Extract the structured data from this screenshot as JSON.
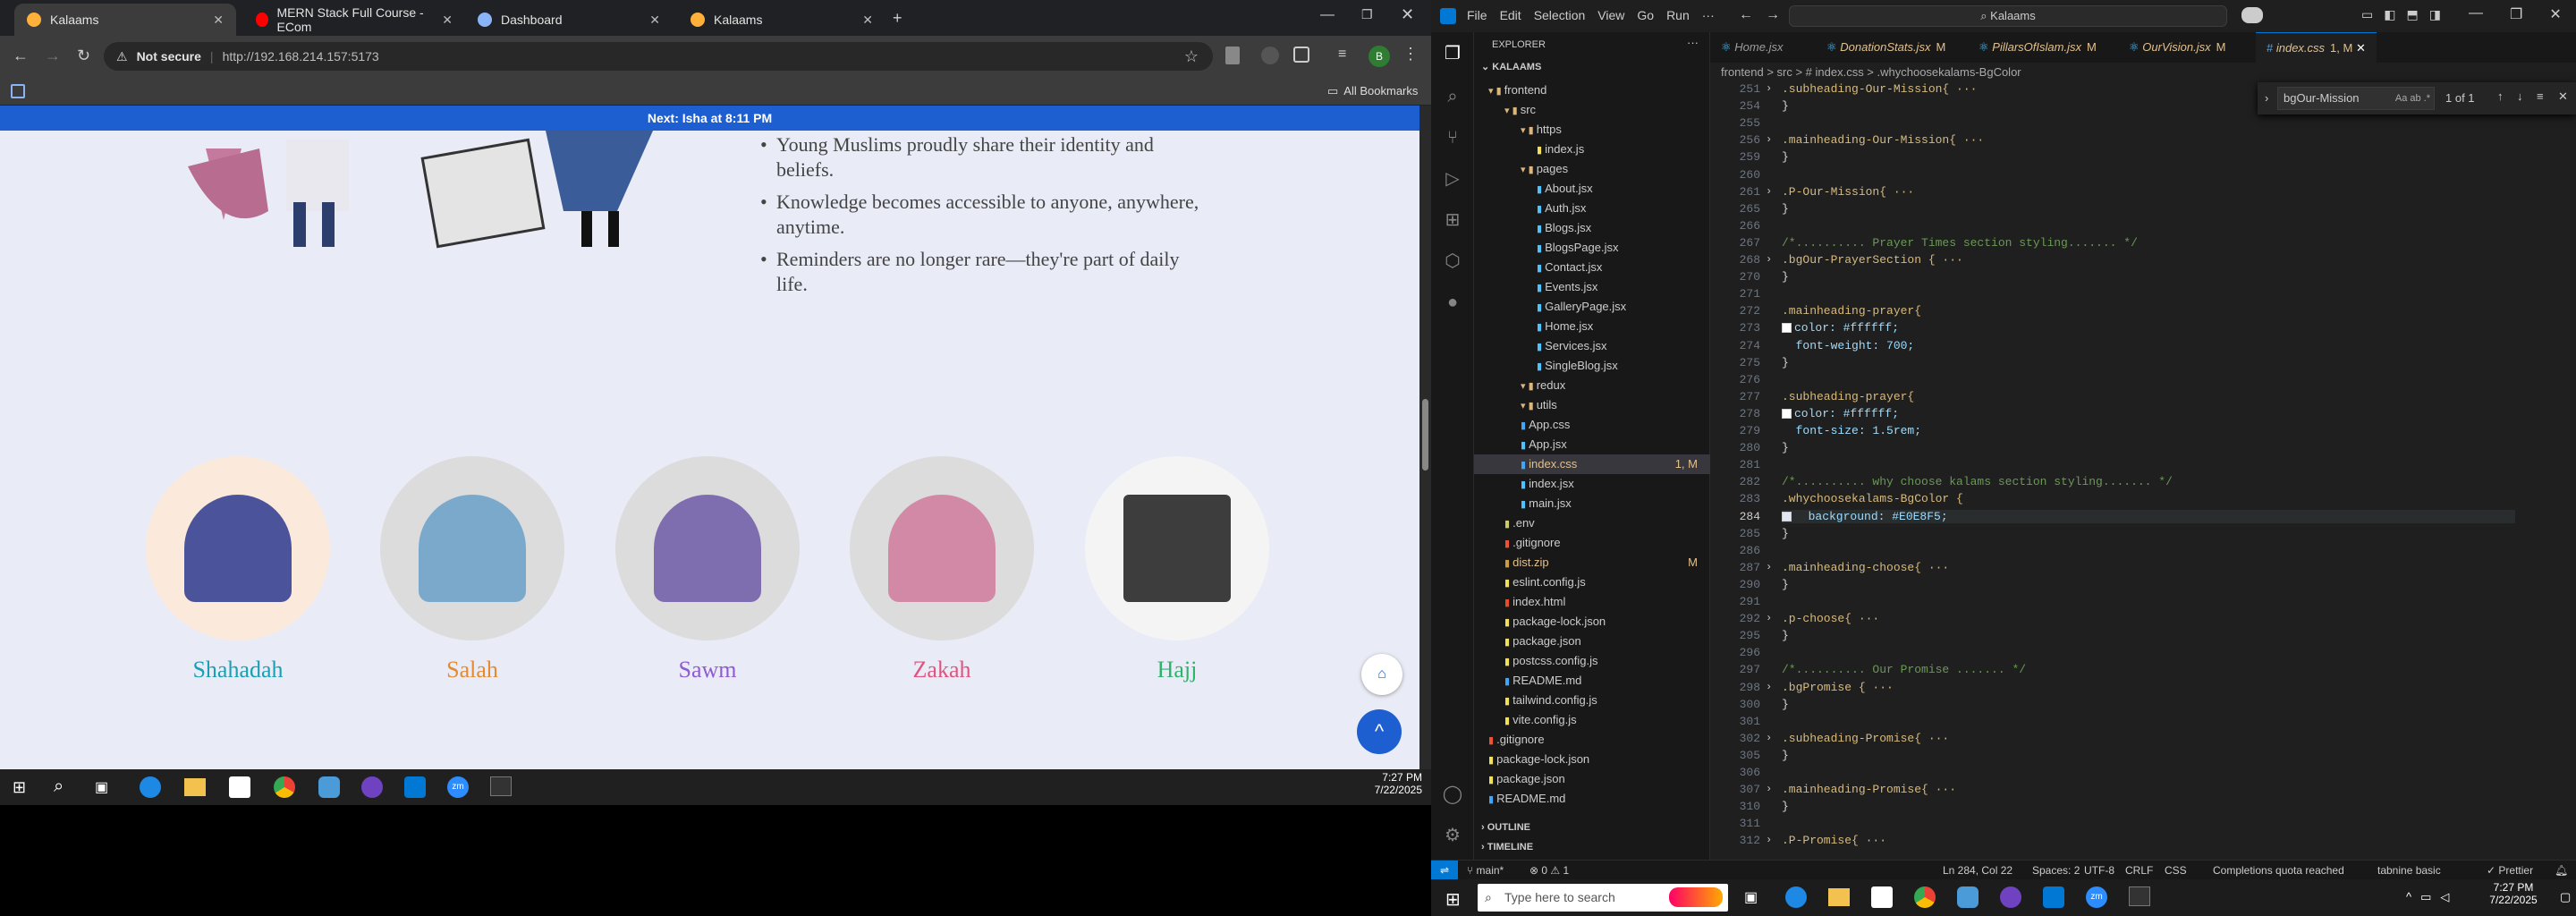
{
  "browser": {
    "tabs": [
      {
        "title": "Kalaams",
        "active": true
      },
      {
        "title": "MERN Stack Full Course - ECom",
        "active": false
      },
      {
        "title": "Dashboard",
        "active": false
      },
      {
        "title": "Kalaams",
        "active": false
      }
    ],
    "security_label": "Not secure",
    "url": "http://192.168.214.157:5173",
    "bookmarks_label": "All Bookmarks",
    "profile_initial": "B"
  },
  "webpage": {
    "ticker": "Next: Isha at 8:11 PM",
    "bullets": [
      "Young Muslims proudly share their identity and",
      "beliefs.",
      "Knowledge becomes accessible to anyone, anywhere,",
      "anytime.",
      "Reminders are no longer rare—they're part of daily",
      "life."
    ],
    "pillars": [
      {
        "label": "Shahadah",
        "color": "#1a9fb5"
      },
      {
        "label": "Salah",
        "color": "#e58a2f"
      },
      {
        "label": "Sawm",
        "color": "#8e5bd1"
      },
      {
        "label": "Zakah",
        "color": "#e0547f"
      },
      {
        "label": "Hajj",
        "color": "#2fb36c"
      }
    ]
  },
  "left_taskbar": {
    "time": "7:27 PM",
    "date": "7/22/2025"
  },
  "vscode": {
    "menu": [
      "File",
      "Edit",
      "Selection",
      "View",
      "Go",
      "Run",
      "···"
    ],
    "search_text": "Kalaams",
    "explorer_title": "EXPLORER",
    "root": "KALAAMS",
    "tree": [
      {
        "label": "frontend",
        "indent": 0,
        "type": "folder"
      },
      {
        "label": "src",
        "indent": 1,
        "type": "folder"
      },
      {
        "label": "https",
        "indent": 2,
        "type": "folder"
      },
      {
        "label": "index.js",
        "indent": 3,
        "type": "js"
      },
      {
        "label": "pages",
        "indent": 2,
        "type": "folder"
      },
      {
        "label": "About.jsx",
        "indent": 3,
        "type": "jsx"
      },
      {
        "label": "Auth.jsx",
        "indent": 3,
        "type": "jsx"
      },
      {
        "label": "Blogs.jsx",
        "indent": 3,
        "type": "jsx"
      },
      {
        "label": "BlogsPage.jsx",
        "indent": 3,
        "type": "jsx"
      },
      {
        "label": "Contact.jsx",
        "indent": 3,
        "type": "jsx"
      },
      {
        "label": "Events.jsx",
        "indent": 3,
        "type": "jsx"
      },
      {
        "label": "GalleryPage.jsx",
        "indent": 3,
        "type": "jsx"
      },
      {
        "label": "Home.jsx",
        "indent": 3,
        "type": "jsx"
      },
      {
        "label": "Services.jsx",
        "indent": 3,
        "type": "jsx"
      },
      {
        "label": "SingleBlog.jsx",
        "indent": 3,
        "type": "jsx"
      },
      {
        "label": "redux",
        "indent": 2,
        "type": "folder"
      },
      {
        "label": "utils",
        "indent": 2,
        "type": "folder"
      },
      {
        "label": "App.css",
        "indent": 2,
        "type": "css"
      },
      {
        "label": "App.jsx",
        "indent": 2,
        "type": "jsx"
      },
      {
        "label": "index.css",
        "indent": 2,
        "type": "css",
        "badge": "1, M",
        "selected": true
      },
      {
        "label": "index.jsx",
        "indent": 2,
        "type": "jsx"
      },
      {
        "label": "main.jsx",
        "indent": 2,
        "type": "jsx"
      },
      {
        "label": ".env",
        "indent": 1,
        "type": "env"
      },
      {
        "label": ".gitignore",
        "indent": 1,
        "type": "git"
      },
      {
        "label": "dist.zip",
        "indent": 1,
        "type": "zip",
        "badge": "M"
      },
      {
        "label": "eslint.config.js",
        "indent": 1,
        "type": "js"
      },
      {
        "label": "index.html",
        "indent": 1,
        "type": "html"
      },
      {
        "label": "package-lock.json",
        "indent": 1,
        "type": "json"
      },
      {
        "label": "package.json",
        "indent": 1,
        "type": "json"
      },
      {
        "label": "postcss.config.js",
        "indent": 1,
        "type": "js"
      },
      {
        "label": "README.md",
        "indent": 1,
        "type": "md"
      },
      {
        "label": "tailwind.config.js",
        "indent": 1,
        "type": "js"
      },
      {
        "label": "vite.config.js",
        "indent": 1,
        "type": "js"
      },
      {
        "label": ".gitignore",
        "indent": 0,
        "type": "git"
      },
      {
        "label": "package-lock.json",
        "indent": 0,
        "type": "json"
      },
      {
        "label": "package.json",
        "indent": 0,
        "type": "json"
      },
      {
        "label": "README.md",
        "indent": 0,
        "type": "md"
      }
    ],
    "outline": "OUTLINE",
    "timeline": "TIMELINE",
    "editor_tabs": [
      {
        "label": "Home.jsx",
        "mod": ""
      },
      {
        "label": "DonationStats.jsx",
        "mod": "M"
      },
      {
        "label": "PillarsOfIslam.jsx",
        "mod": "M"
      },
      {
        "label": "OurVision.jsx",
        "mod": "M"
      },
      {
        "label": "index.css",
        "mod": "1, M",
        "active": true
      }
    ],
    "breadcrumb": "frontend > src > # index.css > .whychoosekalams-BgColor",
    "find": {
      "query": "bgOur-Mission",
      "result": "1 of 1"
    },
    "code_lines": [
      {
        "n": "251",
        "t": ".subheading-Our-Mission{ ··· ",
        "k": "sel",
        "fold": true
      },
      {
        "n": "254",
        "t": "}",
        "k": "pun"
      },
      {
        "n": "255",
        "t": "",
        "k": "pun"
      },
      {
        "n": "256",
        "t": ".mainheading-Our-Mission{ ··· ",
        "k": "sel",
        "fold": true
      },
      {
        "n": "259",
        "t": "}",
        "k": "pun"
      },
      {
        "n": "260",
        "t": "",
        "k": "pun"
      },
      {
        "n": "261",
        "t": ".P-Our-Mission{ ··· ",
        "k": "sel",
        "fold": true
      },
      {
        "n": "265",
        "t": "}",
        "k": "pun"
      },
      {
        "n": "266",
        "t": "",
        "k": "pun"
      },
      {
        "n": "267",
        "t": "/*.......... Prayer Times section styling....... */",
        "k": "cmt"
      },
      {
        "n": "268",
        "t": ".bgOur-PrayerSection { ··· ",
        "k": "sel",
        "fold": true
      },
      {
        "n": "270",
        "t": "}",
        "k": "pun"
      },
      {
        "n": "271",
        "t": "",
        "k": "pun"
      },
      {
        "n": "272",
        "t": ".mainheading-prayer{",
        "k": "sel"
      },
      {
        "n": "273",
        "t": "color: #ffffff;",
        "k": "prop",
        "swatch": "#ffffff"
      },
      {
        "n": "274",
        "t": "  font-weight: 700;",
        "k": "prop"
      },
      {
        "n": "275",
        "t": "}",
        "k": "pun"
      },
      {
        "n": "276",
        "t": "",
        "k": "pun"
      },
      {
        "n": "277",
        "t": ".subheading-prayer{",
        "k": "sel"
      },
      {
        "n": "278",
        "t": "color: #ffffff;",
        "k": "prop",
        "swatch": "#ffffff"
      },
      {
        "n": "279",
        "t": "  font-size: 1.5rem;",
        "k": "prop"
      },
      {
        "n": "280",
        "t": "}",
        "k": "pun"
      },
      {
        "n": "281",
        "t": "",
        "k": "pun"
      },
      {
        "n": "282",
        "t": "/*.......... why choose kalams section styling....... */",
        "k": "cmt"
      },
      {
        "n": "283",
        "t": ".whychoosekalams-BgColor {",
        "k": "sel"
      },
      {
        "n": "284",
        "t": "  background: #E0E8F5;",
        "k": "prop",
        "swatch": "#E0E8F5",
        "current": true
      },
      {
        "n": "285",
        "t": "}",
        "k": "pun"
      },
      {
        "n": "286",
        "t": "",
        "k": "pun"
      },
      {
        "n": "287",
        "t": ".mainheading-choose{ ··· ",
        "k": "sel",
        "fold": true
      },
      {
        "n": "290",
        "t": "}",
        "k": "pun"
      },
      {
        "n": "291",
        "t": "",
        "k": "pun"
      },
      {
        "n": "292",
        "t": ".p-choose{ ··· ",
        "k": "sel",
        "fold": true
      },
      {
        "n": "295",
        "t": "}",
        "k": "pun"
      },
      {
        "n": "296",
        "t": "",
        "k": "pun"
      },
      {
        "n": "297",
        "t": "/*.......... Our Promise ....... */",
        "k": "cmt"
      },
      {
        "n": "298",
        "t": ".bgPromise { ··· ",
        "k": "sel",
        "fold": true
      },
      {
        "n": "300",
        "t": "}",
        "k": "pun"
      },
      {
        "n": "301",
        "t": "",
        "k": "pun"
      },
      {
        "n": "302",
        "t": ".subheading-Promise{ ··· ",
        "k": "sel",
        "fold": true
      },
      {
        "n": "305",
        "t": "}",
        "k": "pun"
      },
      {
        "n": "306",
        "t": "",
        "k": "pun"
      },
      {
        "n": "307",
        "t": ".mainheading-Promise{ ··· ",
        "k": "sel",
        "fold": true
      },
      {
        "n": "310",
        "t": "}",
        "k": "pun"
      },
      {
        "n": "311",
        "t": "",
        "k": "pun"
      },
      {
        "n": "312",
        "t": ".P-Promise{ ··· ",
        "k": "sel",
        "fold": true
      }
    ],
    "status": {
      "branch": "main*",
      "problems": "⊗ 0 ⚠ 1",
      "cursor": "Ln 284, Col 22",
      "spaces": "Spaces: 2",
      "encoding": "UTF-8",
      "eol": "CRLF",
      "language": "CSS",
      "quota": "Completions quota reached",
      "tabnine": "tabnine basic",
      "prettier": "Prettier"
    }
  },
  "win_taskbar": {
    "search_placeholder": "Type here to search",
    "time": "7:27 PM",
    "date": "7/22/2025"
  }
}
